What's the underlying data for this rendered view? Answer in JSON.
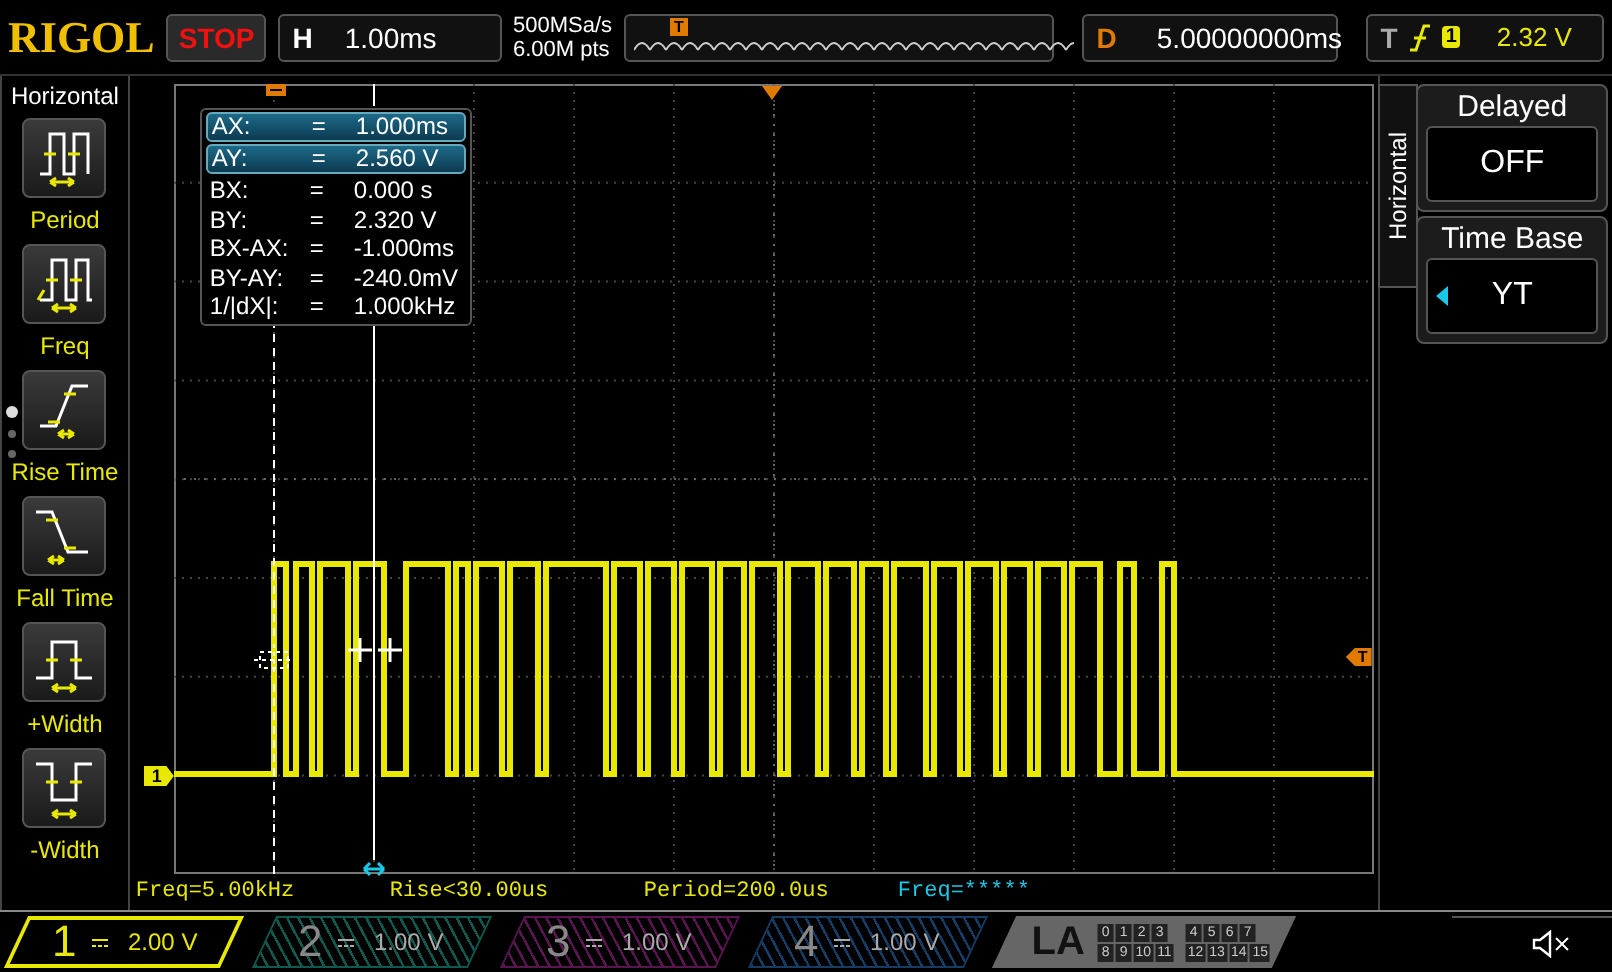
{
  "top_bar": {
    "logo": "RIGOL",
    "run_state": "STOP",
    "horizontal": {
      "label": "H",
      "scale": "1.00ms"
    },
    "sample_rate": "500MSa/s",
    "memory_depth": "6.00M pts",
    "memory_marker": "T",
    "delay": {
      "label": "D",
      "value": "5.00000000ms"
    },
    "trigger": {
      "label": "T",
      "source": "1",
      "level": "2.32 V"
    }
  },
  "sidebar": {
    "title": "Horizontal",
    "items": [
      {
        "kind": "period",
        "label": "Period"
      },
      {
        "kind": "freq",
        "label": "Freq"
      },
      {
        "kind": "rise",
        "label": "Rise Time"
      },
      {
        "kind": "fall",
        "label": "Fall Time"
      },
      {
        "kind": "pwidth",
        "label": "+Width"
      },
      {
        "kind": "nwidth",
        "label": "-Width"
      }
    ],
    "page_dots": [
      {
        "selected": true
      },
      {
        "selected": false
      },
      {
        "selected": false
      }
    ]
  },
  "screen": {
    "trigger_marker": "T",
    "channel_marker": "1",
    "cursor_readout": [
      {
        "label": "AX:",
        "eq": "=",
        "value": "1.000ms",
        "selected": true
      },
      {
        "label": "AY:",
        "eq": "=",
        "value": "2.560 V",
        "selected": true
      },
      {
        "label": "BX:",
        "eq": "=",
        "value": "0.000 s",
        "selected": false
      },
      {
        "label": "BY:",
        "eq": "=",
        "value": "2.320 V",
        "selected": false
      },
      {
        "label": "BX-AX:",
        "eq": "=",
        "value": "-1.000ms",
        "selected": false
      },
      {
        "label": "BY-AY:",
        "eq": "=",
        "value": "-240.0mV",
        "selected": false
      },
      {
        "label": "1/|dX|:",
        "eq": "=",
        "value": "1.000kHz",
        "selected": false
      }
    ]
  },
  "measurements": [
    {
      "text": "Freq=5.00kHz",
      "color": "#e8e800"
    },
    {
      "text": "Rise<30.00us",
      "color": "#e8e800"
    },
    {
      "text": "Period=200.0us",
      "color": "#e8e800"
    },
    {
      "text": "Freq=*****",
      "color": "#19c8e6"
    }
  ],
  "right_panel": {
    "tab": "Horizontal",
    "sections": [
      {
        "title": "Delayed",
        "value": "OFF",
        "selectable": false
      },
      {
        "title": "Time Base",
        "value": "YT",
        "selectable": true
      }
    ]
  },
  "channels": [
    {
      "number": "1",
      "scale": "2.00 V",
      "selected": true,
      "color": "#e8e800"
    },
    {
      "number": "2",
      "scale": "1.00 V",
      "selected": false,
      "color": "#0f5a50"
    },
    {
      "number": "3",
      "scale": "1.00 V",
      "selected": false,
      "color": "#5a1450"
    },
    {
      "number": "4",
      "scale": "1.00 V",
      "selected": false,
      "color": "#143c64"
    }
  ],
  "la": {
    "label": "LA",
    "groups": [
      [
        "0",
        "1",
        "2",
        "3"
      ],
      [
        "4",
        "5",
        "6",
        "7"
      ],
      [
        "8",
        "9",
        "10",
        "11"
      ],
      [
        "12",
        "13",
        "14",
        "15"
      ]
    ]
  }
}
